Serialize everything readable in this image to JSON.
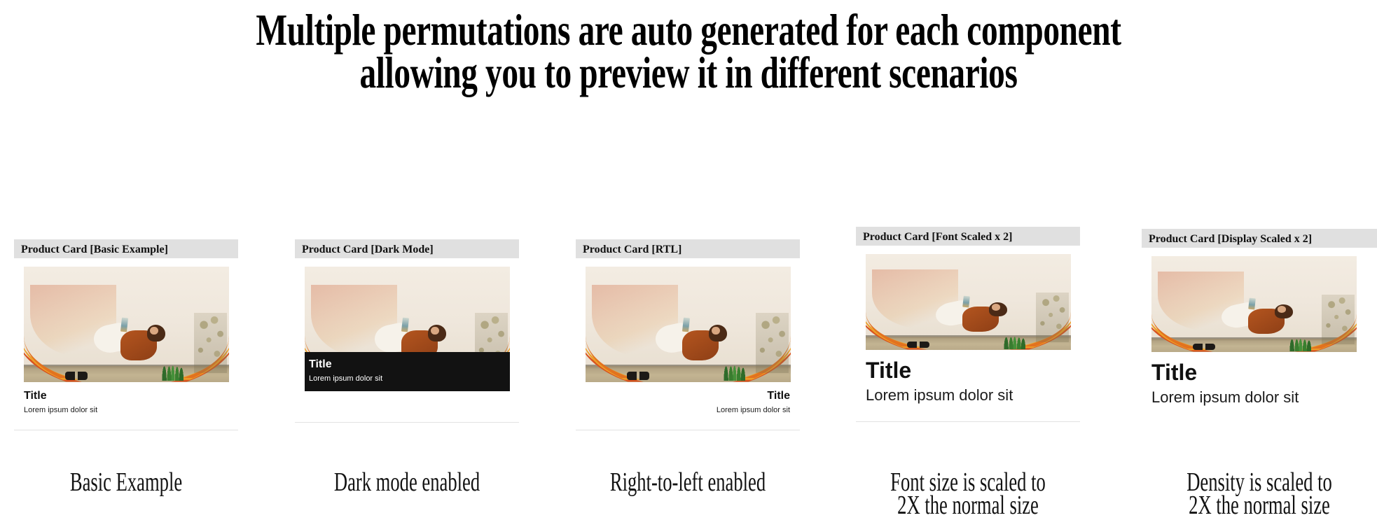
{
  "headline": {
    "line1": "Multiple permutations are auto generated for each component",
    "line2": "allowing you to preview it in different scenarios"
  },
  "image": {
    "alt": "Woman relaxing in an orange hammock against a cream wall with an agave plant and sandals on the ground"
  },
  "cards": [
    {
      "label": "Product Card [Basic Example]",
      "title": "Title",
      "subtitle": "Lorem ipsum dolor sit",
      "caption": "Basic Example",
      "mode": "light"
    },
    {
      "label": "Product Card [Dark Mode]",
      "title": "Title",
      "subtitle": "Lorem ipsum dolor sit",
      "caption": "Dark mode enabled",
      "mode": "dark"
    },
    {
      "label": "Product Card [RTL]",
      "title": "Title",
      "subtitle": "Lorem ipsum dolor sit",
      "caption": "Right-to-left enabled",
      "mode": "rtl"
    },
    {
      "label": "Product Card [Font Scaled x 2]",
      "title": "Title",
      "subtitle": "Lorem ipsum dolor sit",
      "caption_line1": "Font size is scaled to",
      "caption_line2": "2X the normal size",
      "mode": "font-scaled"
    },
    {
      "label": "Product Card [Display Scaled x 2]",
      "title": "Title",
      "subtitle": "Lorem ipsum dolor sit",
      "caption_line1": "Density is scaled to",
      "caption_line2": "2X the normal size",
      "mode": "display-scaled"
    }
  ],
  "colors": {
    "label_bar_bg": "#e0e0e0",
    "page_bg": "#ffffff",
    "text": "#111111",
    "dark_panel": "#121212",
    "card_border": "#e2e2e2",
    "hammock_orange": "#e2721f",
    "hammock_yellow": "#eda028",
    "hammock_red": "#d8531f"
  }
}
